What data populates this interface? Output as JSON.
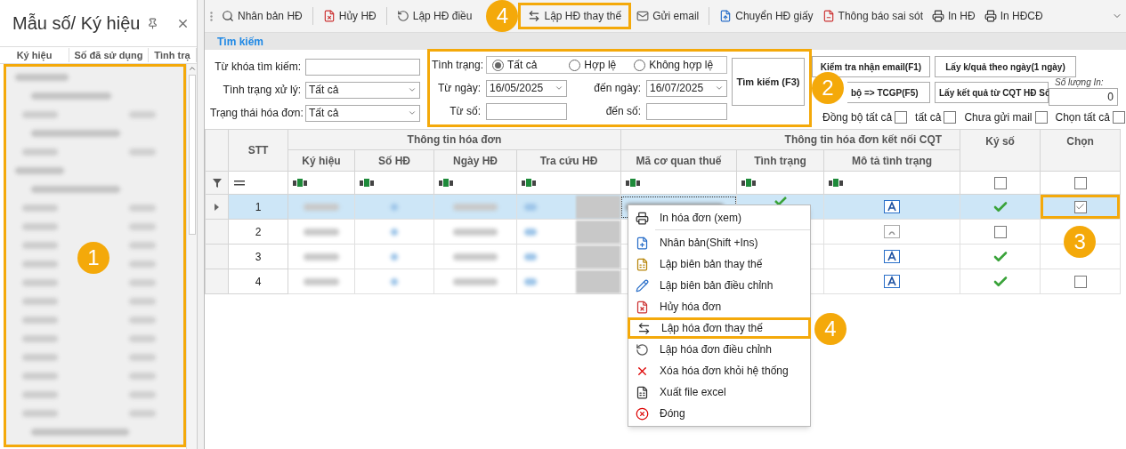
{
  "sidebar": {
    "title": "Mẫu số/ Ký hiệu",
    "columns": [
      "Ký hiệu",
      "Số đã sử dụng",
      "Tình trạ"
    ],
    "highlighted": true,
    "badge": "1"
  },
  "toolbar": {
    "items": [
      {
        "label": "Nhân bản HĐ",
        "highlighted": false
      },
      {
        "label": "Hủy HĐ",
        "highlighted": false
      },
      {
        "label": "Lập HĐ điều",
        "highlighted": false
      },
      {
        "label": "Lập HĐ thay thế",
        "highlighted": true,
        "badge": "4"
      },
      {
        "label": "Gửi email",
        "highlighted": false
      },
      {
        "label": "Chuyển HĐ giấy",
        "highlighted": false
      },
      {
        "label": "Thông báo sai sót",
        "highlighted": false
      },
      {
        "label": "In HĐ",
        "highlighted": false
      },
      {
        "label": "In HĐCĐ",
        "highlighted": false
      }
    ]
  },
  "search": {
    "title": "Tìm kiếm",
    "keyword_label": "Từ khóa tìm kiếm:",
    "processing_label": "Tình trạng xử lý:",
    "processing_value": "Tất cả",
    "invoice_state_label": "Trạng thái hóa đơn:",
    "invoice_state_value": "Tất cả",
    "highlighted": true,
    "badge": "2",
    "status_label": "Tình trạng:",
    "status_options": [
      {
        "label": "Tất cả",
        "selected": true
      },
      {
        "label": "Hợp lệ",
        "selected": false
      },
      {
        "label": "Không hợp lệ",
        "selected": false
      }
    ],
    "from_date_label": "Từ ngày:",
    "from_date": "16/05/2025",
    "to_date_label": "đến ngày:",
    "to_date": "16/07/2025",
    "from_no_label": "Từ số:",
    "to_no_label": "đến số:",
    "search_button": "Tìm kiếm (F3)"
  },
  "actions": {
    "buttons": [
      "Kiểm tra nhận email(F1)",
      "Lấy k/quả theo ngày(1 ngày)",
      "bộ => TCGP(F5)",
      "Lấy kết quả từ CQT HĐ Số"
    ],
    "quantity_label": "Số lượng In:",
    "quantity_value": "0",
    "checks": [
      {
        "label": "Đồng bộ tất cả",
        "checked": false
      },
      {
        "label": "tất cả",
        "checked": false
      },
      {
        "label": "Chưa gửi mail",
        "checked": false
      },
      {
        "label": "Chọn tất cả",
        "checked": false
      }
    ]
  },
  "grid": {
    "group_headers": [
      "Thông tin hóa đơn",
      "Thông tin hóa đơn kết nối CQT"
    ],
    "columns": [
      "STT",
      "Ký hiệu",
      "Số HĐ",
      "Ngày HĐ",
      "Tra cứu HĐ",
      "Mã cơ quan thuế",
      "Tình trạng",
      "Mô tả tình trạng",
      "Ký số",
      "Chọn"
    ],
    "filter": {
      "signed_checked": false,
      "chosen_checked": false
    },
    "rows": [
      {
        "stt": "1",
        "selected": true,
        "status_ok": true,
        "description_active": true,
        "signed": true,
        "chosen": true,
        "highlighted": true,
        "badge": "3"
      },
      {
        "stt": "2",
        "selected": false,
        "description_active": false,
        "signed": false,
        "highlighted": false
      },
      {
        "stt": "3",
        "selected": false,
        "description_active": true,
        "signed": true,
        "highlighted": false
      },
      {
        "stt": "4",
        "selected": false,
        "description_active": true,
        "signed": true,
        "chosen": false,
        "highlighted": false
      }
    ]
  },
  "context_menu": {
    "items": [
      {
        "kind": "item",
        "label": "In hóa đơn (xem)",
        "highlighted": false
      },
      {
        "kind": "separator"
      },
      {
        "kind": "item",
        "label": "Nhân bản(Shift +Ins)",
        "highlighted": false
      },
      {
        "kind": "item",
        "label": "Lập biên bản thay thế",
        "highlighted": false
      },
      {
        "kind": "item",
        "label": "Lập biên bản điều chỉnh",
        "highlighted": false
      },
      {
        "kind": "item",
        "label": "Hủy hóa đơn",
        "highlighted": false
      },
      {
        "kind": "item",
        "label": "Lập hóa đơn thay thế",
        "highlighted": true,
        "badge": "4"
      },
      {
        "kind": "item",
        "label": "Lập hóa đơn điều chỉnh",
        "highlighted": false
      },
      {
        "kind": "item",
        "label": "Xóa hóa đơn khỏi hệ thống",
        "highlighted": false
      },
      {
        "kind": "item",
        "label": "Xuất file excel",
        "highlighted": false
      },
      {
        "kind": "item",
        "label": "Đóng",
        "highlighted": false
      }
    ]
  }
}
